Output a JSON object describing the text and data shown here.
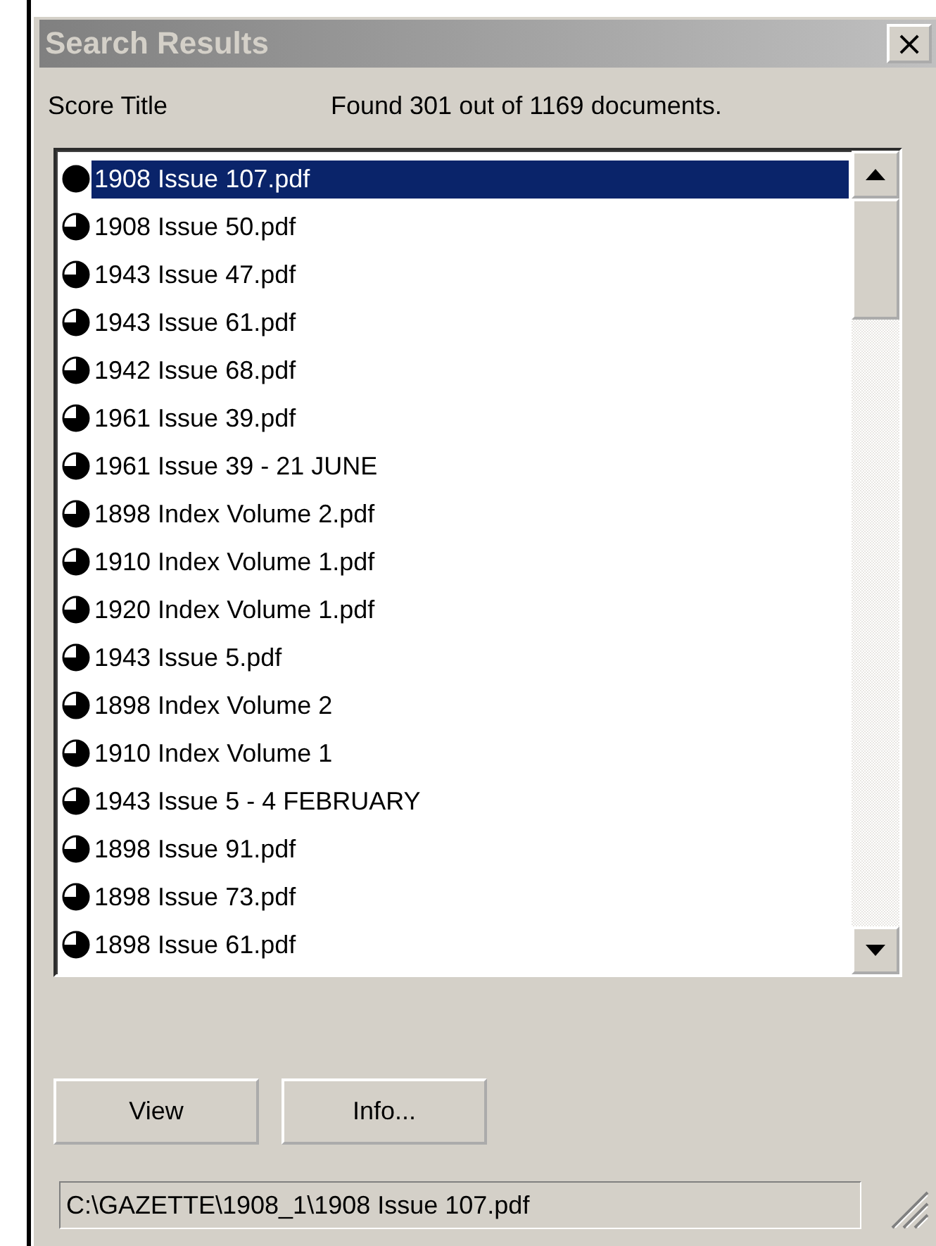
{
  "window": {
    "title": "Search Results",
    "close": "×"
  },
  "header": {
    "column_label": "Score Title",
    "summary": "Found 301 out of 1169 documents."
  },
  "results": [
    {
      "title": "1908 Issue 107.pdf",
      "kind": "full",
      "selected": true
    },
    {
      "title": "1908 Issue 50.pdf",
      "kind": "three_quarter",
      "selected": false
    },
    {
      "title": "1943 Issue 47.pdf",
      "kind": "three_quarter",
      "selected": false
    },
    {
      "title": "1943 Issue 61.pdf",
      "kind": "three_quarter",
      "selected": false
    },
    {
      "title": "1942 Issue 68.pdf",
      "kind": "three_quarter",
      "selected": false
    },
    {
      "title": "1961 Issue 39.pdf",
      "kind": "three_quarter",
      "selected": false
    },
    {
      "title": "1961 Issue 39 - 21 JUNE",
      "kind": "three_quarter",
      "selected": false
    },
    {
      "title": "1898 Index Volume 2.pdf",
      "kind": "three_quarter",
      "selected": false
    },
    {
      "title": "1910 Index Volume 1.pdf",
      "kind": "three_quarter",
      "selected": false
    },
    {
      "title": "1920 Index Volume 1.pdf",
      "kind": "three_quarter",
      "selected": false
    },
    {
      "title": "1943 Issue 5.pdf",
      "kind": "three_quarter",
      "selected": false
    },
    {
      "title": "1898 Index Volume 2",
      "kind": "three_quarter",
      "selected": false
    },
    {
      "title": "1910 Index Volume 1",
      "kind": "three_quarter",
      "selected": false
    },
    {
      "title": "1943 Issue 5 - 4 FEBRUARY",
      "kind": "three_quarter",
      "selected": false
    },
    {
      "title": "1898 Issue 91.pdf",
      "kind": "three_quarter",
      "selected": false
    },
    {
      "title": "1898 Issue 73.pdf",
      "kind": "three_quarter",
      "selected": false
    },
    {
      "title": "1898 Issue 61.pdf",
      "kind": "three_quarter",
      "selected": false
    }
  ],
  "buttons": [
    "View",
    "Info..."
  ],
  "status_path": "C:\\GAZETTE\\1908_1\\1908 Issue 107.pdf"
}
